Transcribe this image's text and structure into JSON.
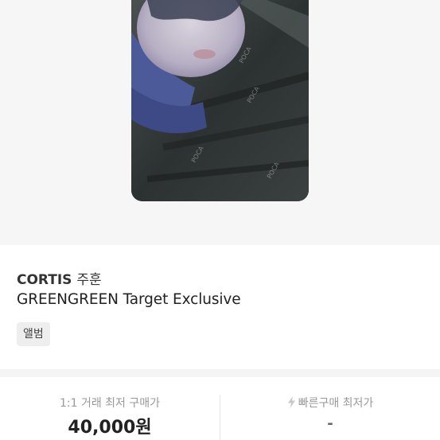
{
  "product": {
    "artist": "CORTIS",
    "member": "주훈",
    "title": "GREENGREEN Target Exclusive",
    "tag": "앨범",
    "image_icon": "photocard-image"
  },
  "prices": {
    "lowest_trade_label": "1:1 거래 최저 구매가",
    "lowest_trade_value": "40,000원",
    "quick_buy_label": "빠른구매 최저가",
    "quick_buy_value": "-",
    "quick_buy_icon": "lightning-bolt-icon"
  },
  "colors": {
    "background": "#f6f6f6",
    "text_primary": "#222222",
    "text_muted": "#999999",
    "tag_background": "#eeeeee"
  }
}
